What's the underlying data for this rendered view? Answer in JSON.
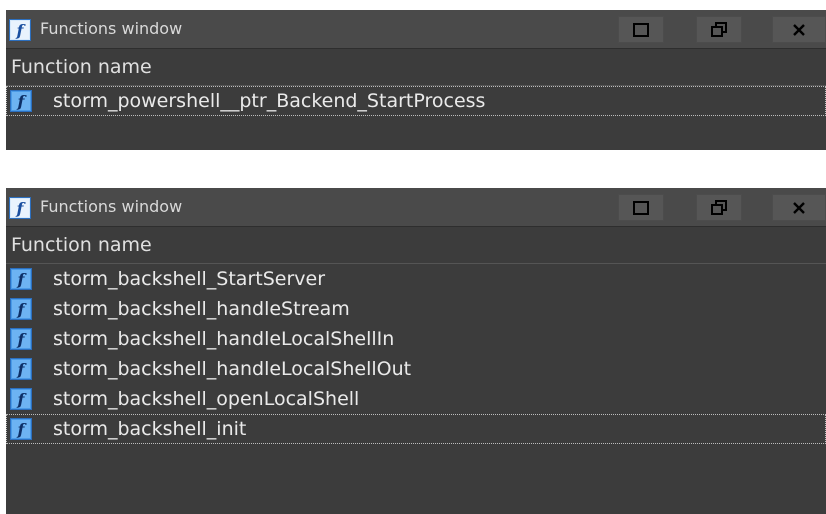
{
  "windows": [
    {
      "title": "Functions window",
      "column_header": "Function name",
      "controls": {
        "maximize": "maximize-icon",
        "restore": "restore-icon",
        "close": "close-icon"
      },
      "rows": [
        {
          "name": "storm_powershell__ptr_Backend_StartProcess",
          "selected": true
        }
      ]
    },
    {
      "title": "Functions window",
      "column_header": "Function name",
      "controls": {
        "maximize": "maximize-icon",
        "restore": "restore-icon",
        "close": "close-icon"
      },
      "rows": [
        {
          "name": "storm_backshell_StartServer",
          "selected": false
        },
        {
          "name": "storm_backshell_handleStream",
          "selected": false
        },
        {
          "name": "storm_backshell_handleLocalShellIn",
          "selected": false
        },
        {
          "name": "storm_backshell_handleLocalShellOut",
          "selected": false
        },
        {
          "name": "storm_backshell_openLocalShell",
          "selected": false
        },
        {
          "name": "storm_backshell_init",
          "selected": true
        }
      ]
    }
  ],
  "colors": {
    "panel_bg": "#3c3c3c",
    "titlebar_bg": "#4a4a4a",
    "icon_blue": "#3a8ee6"
  }
}
